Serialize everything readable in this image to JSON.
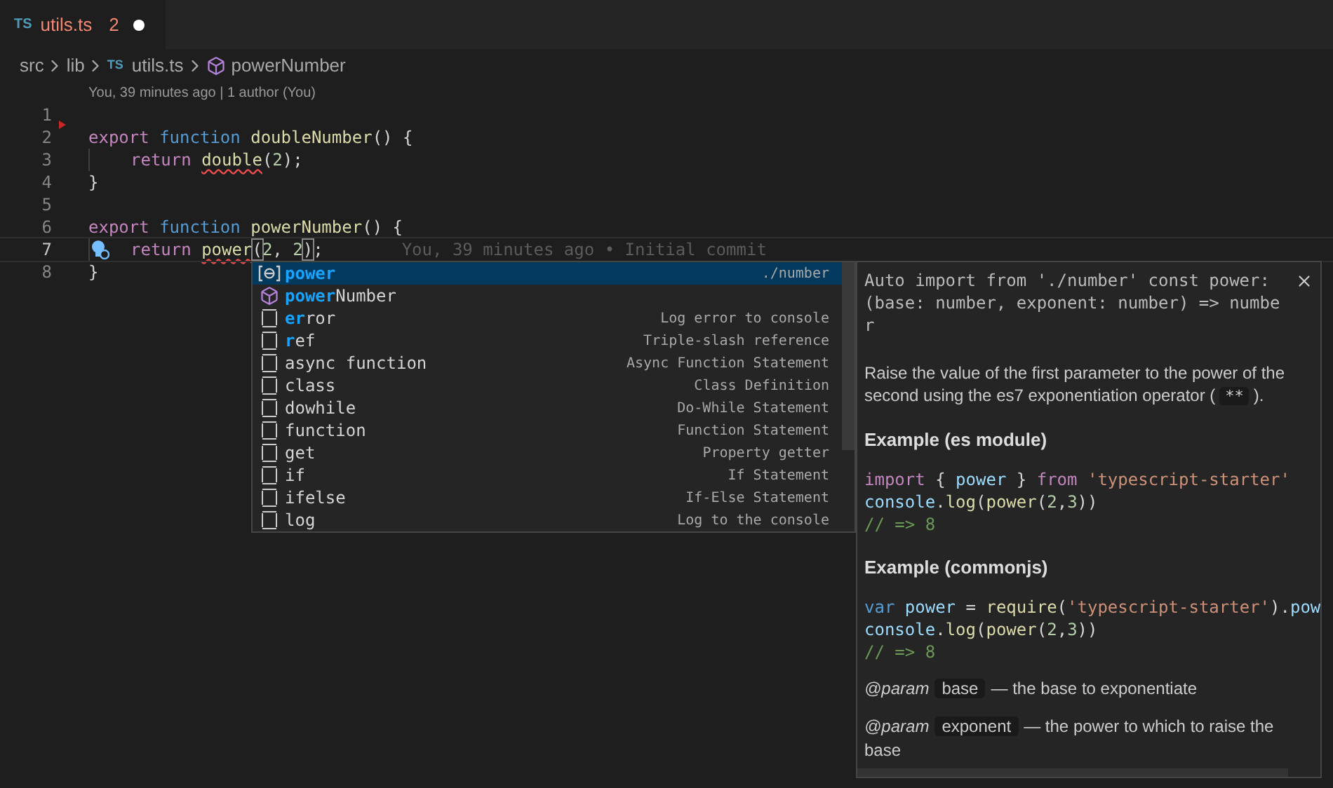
{
  "tabs": [
    {
      "icon": "TS",
      "label": "utils.ts",
      "problems": "2",
      "modified": true,
      "selected": true
    }
  ],
  "breadcrumbs": [
    {
      "kind": "folder",
      "label": "src"
    },
    {
      "kind": "folder",
      "label": "lib"
    },
    {
      "kind": "file",
      "icon": "TS",
      "label": "utils.ts"
    },
    {
      "kind": "function",
      "label": "powerNumber"
    }
  ],
  "codelens": "You, 39 minutes ago | 1 author (You)",
  "lines": [
    {
      "number": "1",
      "current": false,
      "indented": false
    },
    {
      "number": "2",
      "current": false,
      "indented": false,
      "tokens": [
        {
          "text": "export ",
          "kind": "keyword"
        },
        {
          "text": "function ",
          "kind": "storage"
        },
        {
          "text": "doubleNumber",
          "kind": "function"
        },
        {
          "text": "() {",
          "kind": "text"
        }
      ]
    },
    {
      "number": "3",
      "current": false,
      "indented": true,
      "tokens": [
        {
          "text": "return ",
          "kind": "keyword"
        },
        {
          "text": "double",
          "kind": "function",
          "squiggle": true
        },
        {
          "text": "(",
          "kind": "text"
        },
        {
          "text": "2",
          "kind": "number"
        },
        {
          "text": ");",
          "kind": "text"
        }
      ]
    },
    {
      "number": "4",
      "current": false,
      "indented": false,
      "tokens": [
        {
          "text": "}",
          "kind": "text"
        }
      ]
    },
    {
      "number": "5",
      "current": false,
      "indented": false
    },
    {
      "number": "6",
      "current": false,
      "indented": false,
      "tokens": [
        {
          "text": "export ",
          "kind": "keyword"
        },
        {
          "text": "function ",
          "kind": "storage"
        },
        {
          "text": "powerNumber",
          "kind": "function"
        },
        {
          "text": "() {",
          "kind": "text"
        }
      ]
    },
    {
      "number": "7",
      "current": true,
      "indented": true,
      "lightbulb": true,
      "tokens": [
        {
          "text": "return ",
          "kind": "keyword"
        },
        {
          "text": "power",
          "kind": "function",
          "squiggle": true
        },
        {
          "text": "(",
          "kind": "text",
          "boxed": true
        },
        {
          "text": "2",
          "kind": "number"
        },
        {
          "text": ", ",
          "kind": "text"
        },
        {
          "text": "2",
          "kind": "number"
        },
        {
          "text": ")",
          "kind": "text",
          "boxed": true
        },
        {
          "text": ";",
          "kind": "text"
        }
      ],
      "blame": "You, 39 minutes ago • Initial commit"
    },
    {
      "number": "8",
      "current": false,
      "indented": false,
      "tokens": [
        {
          "text": "}",
          "kind": "text"
        }
      ]
    }
  ],
  "suggestions": [
    {
      "kind": "variable",
      "match": "power",
      "detail": "./number",
      "selected": true
    },
    {
      "kind": "module",
      "match": "power",
      "rest": "Number",
      "selected": false
    },
    {
      "kind": "snippet",
      "match": "er",
      "rest": "ror",
      "detail": "Log error to console",
      "selected": false
    },
    {
      "kind": "snippet",
      "match": "r",
      "rest": "ef",
      "detail": "Triple-slash reference",
      "selected": false
    },
    {
      "kind": "snippet",
      "rest": "async function",
      "detail": "Async Function Statement",
      "selected": false
    },
    {
      "kind": "snippet",
      "rest": "class",
      "detail": "Class Definition",
      "selected": false
    },
    {
      "kind": "snippet",
      "rest": "dowhile",
      "detail": "Do-While Statement",
      "selected": false
    },
    {
      "kind": "snippet",
      "rest": "function",
      "detail": "Function Statement",
      "selected": false
    },
    {
      "kind": "snippet",
      "rest": "get",
      "detail": "Property getter",
      "selected": false
    },
    {
      "kind": "snippet",
      "rest": "if",
      "detail": "If Statement",
      "selected": false
    },
    {
      "kind": "snippet",
      "rest": "ifelse",
      "detail": "If-Else Statement",
      "selected": false
    },
    {
      "kind": "snippet",
      "rest": "log",
      "detail": "Log to the console",
      "selected": false
    }
  ],
  "doc": {
    "signature": "Auto import from './number' const power: (base: number, exponent: number) => number",
    "blocks": [
      {
        "kind": "paragraph",
        "segments": [
          {
            "text": "Raise the value of the first parameter to the power of the second using the es7 exponentiation operator (",
            "code": false
          },
          {
            "text": "**",
            "code": true
          },
          {
            "text": ").",
            "code": false
          }
        ]
      },
      {
        "kind": "heading",
        "text": "Example (es module)"
      },
      {
        "kind": "code",
        "lines": [
          [
            {
              "text": "import",
              "kind": "keyword"
            },
            {
              "text": " { ",
              "kind": "text"
            },
            {
              "text": "power",
              "kind": "variable"
            },
            {
              "text": " } ",
              "kind": "text"
            },
            {
              "text": "from ",
              "kind": "keyword"
            },
            {
              "text": "'typescript-starter'",
              "kind": "string"
            }
          ],
          [
            {
              "text": "console",
              "kind": "variable"
            },
            {
              "text": ".",
              "kind": "text"
            },
            {
              "text": "log",
              "kind": "function"
            },
            {
              "text": "(",
              "kind": "text"
            },
            {
              "text": "power",
              "kind": "function"
            },
            {
              "text": "(",
              "kind": "text"
            },
            {
              "text": "2",
              "kind": "number"
            },
            {
              "text": ",",
              "kind": "text"
            },
            {
              "text": "3",
              "kind": "number"
            },
            {
              "text": "))",
              "kind": "text"
            }
          ],
          [
            {
              "text": "// => 8",
              "kind": "comment"
            }
          ]
        ]
      },
      {
        "kind": "heading",
        "text": "Example (commonjs)"
      },
      {
        "kind": "code",
        "lines": [
          [
            {
              "text": "var ",
              "kind": "storage"
            },
            {
              "text": "power",
              "kind": "variable"
            },
            {
              "text": " = ",
              "kind": "text"
            },
            {
              "text": "require",
              "kind": "function"
            },
            {
              "text": "(",
              "kind": "text"
            },
            {
              "text": "'typescript-starter'",
              "kind": "string"
            },
            {
              "text": ").",
              "kind": "text"
            },
            {
              "text": "pow",
              "kind": "variable"
            }
          ],
          [
            {
              "text": "console",
              "kind": "variable"
            },
            {
              "text": ".",
              "kind": "text"
            },
            {
              "text": "log",
              "kind": "function"
            },
            {
              "text": "(",
              "kind": "text"
            },
            {
              "text": "power",
              "kind": "function"
            },
            {
              "text": "(",
              "kind": "text"
            },
            {
              "text": "2",
              "kind": "number"
            },
            {
              "text": ",",
              "kind": "text"
            },
            {
              "text": "3",
              "kind": "number"
            },
            {
              "text": "))",
              "kind": "text"
            }
          ],
          [
            {
              "text": "// => 8",
              "kind": "comment"
            }
          ]
        ]
      },
      {
        "kind": "param",
        "tag": "@param",
        "name": "base",
        "text": "— the base to exponentiate"
      },
      {
        "kind": "param",
        "tag": "@param",
        "name": "exponent",
        "text": "— the power to which to raise the base"
      }
    ]
  }
}
